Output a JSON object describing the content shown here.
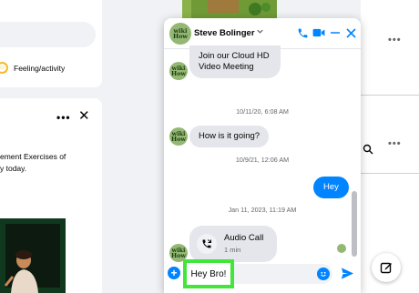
{
  "chat": {
    "contact_name": "Steve Bolinger",
    "avatar_text": [
      "wiki",
      "How"
    ],
    "messages": [
      {
        "type": "incoming",
        "text": "Join our Cloud HD Video Meeting",
        "lines": [
          "Join our Cloud HD",
          "Video Meeting"
        ]
      },
      {
        "type": "timestamp",
        "text": "10/11/20, 6:08 AM"
      },
      {
        "type": "incoming",
        "text": "How is it going?"
      },
      {
        "type": "timestamp",
        "text": "10/9/21, 12:06 AM"
      },
      {
        "type": "outgoing",
        "text": "Hey"
      },
      {
        "type": "timestamp",
        "text": "Jan 11, 2023, 11:19 AM"
      },
      {
        "type": "call",
        "title": "Audio Call",
        "duration": "1 min"
      }
    ],
    "input_value": "Hey Bro!"
  },
  "feed": {
    "feeling_label": "Feeling/activity",
    "post_text_lines": [
      "ement Exercises of",
      "y today."
    ]
  },
  "colors": {
    "messenger_blue": "#0084ff",
    "highlight_green": "#42e63b",
    "bubble_gray": "#e4e6eb",
    "page_bg": "#f0f2f5"
  },
  "icons": [
    "phone-icon",
    "video-camera-icon",
    "minimize-icon",
    "close-icon",
    "plus-icon",
    "emoji-icon",
    "send-icon",
    "compose-icon",
    "missed-call-icon",
    "chevron-down-icon"
  ]
}
